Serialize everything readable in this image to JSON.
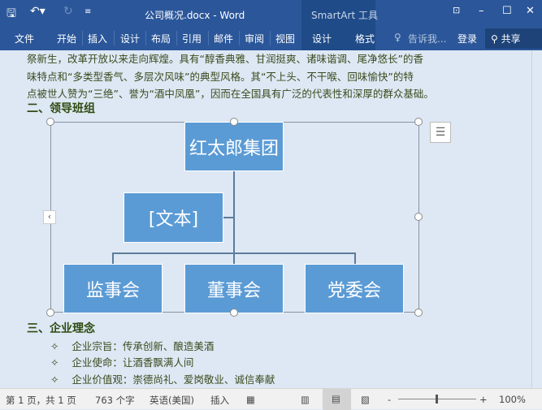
{
  "titlebar": {
    "doc_title": "公司概况.docx - Word",
    "context_title": "SmartArt 工具"
  },
  "ribbon": {
    "tabs": [
      "文件",
      "开始",
      "插入",
      "设计",
      "布局",
      "引用",
      "邮件",
      "审阅",
      "视图"
    ],
    "context_tabs": [
      "设计",
      "格式"
    ],
    "tell_me": "告诉我...",
    "login": "登录",
    "share": "共享"
  },
  "document": {
    "lines": [
      "祭新生，改革开放以来走向辉煌。具有“醇香典雅、甘润挺爽、诸味谐调、尾净悠长”的香",
      "味特点和“多类型香气、多层次风味”的典型风格。其“不上头、不干喉、回味愉快”的特",
      "点被世人赞为“三绝”、誉为“酒中凤凰”，因而在全国具有广泛的代表性和深厚的群众基础。"
    ],
    "heading2": "二、领导班组",
    "smartart": {
      "top": "红太郎集团",
      "assistant": "[文本]",
      "children": [
        "监事会",
        "董事会",
        "党委会"
      ]
    },
    "heading3": "三、企业理念",
    "bullets": [
      "企业宗旨：传承创新、酿造美酒",
      "企业使命：让酒香飘满人间",
      "企业价值观：崇德尚礼、爱岗敬业、诚信奉献"
    ]
  },
  "status": {
    "page": "第 1 页，共 1 页",
    "words": "763 个字",
    "language": "英语(美国)",
    "mode": "插入",
    "zoom": "100%"
  }
}
